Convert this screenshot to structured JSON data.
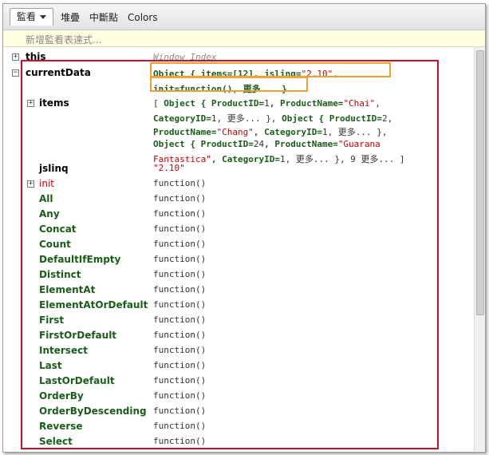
{
  "tabs": {
    "watch": "監看",
    "stack": "堆疊",
    "breakpoints": "中斷點",
    "colors": "Colors"
  },
  "add_watch_placeholder": "新增監看表達式...",
  "this_row": {
    "name": "this",
    "value": "Window",
    "value_suffix": "Index"
  },
  "currentData": {
    "name": "currentData",
    "summary_line1": {
      "prefix": "Object { ",
      "items": "items=[12]",
      "sep": ",  jslinq=",
      "jslinq": "\"2.10\"",
      "end": ","
    },
    "summary_line2": "init=function(),  更多... }"
  },
  "items_row": {
    "name": "items",
    "lines": [
      [
        {
          "t": "[ ",
          "c": "plain"
        },
        {
          "t": "Object { ",
          "c": "obj"
        },
        {
          "t": " ProductID=",
          "c": "obj"
        },
        {
          "t": "1",
          "c": "plain"
        },
        {
          "t": ",  ProductName=",
          "c": "obj"
        },
        {
          "t": "\"Chai\"",
          "c": "str"
        },
        {
          "t": ",",
          "c": "plain"
        }
      ],
      [
        {
          "t": "CategoryID=",
          "c": "obj"
        },
        {
          "t": "1",
          "c": "plain"
        },
        {
          "t": ",  更多... }",
          "c": "plain"
        },
        {
          "t": ", ",
          "c": "plain"
        },
        {
          "t": "Object { ",
          "c": "obj"
        },
        {
          "t": " ProductID=",
          "c": "obj"
        },
        {
          "t": "2",
          "c": "plain"
        },
        {
          "t": ",",
          "c": "plain"
        }
      ],
      [
        {
          "t": "ProductName=",
          "c": "obj"
        },
        {
          "t": "\"Chang\"",
          "c": "str"
        },
        {
          "t": ",  CategoryID=",
          "c": "obj"
        },
        {
          "t": "1",
          "c": "plain"
        },
        {
          "t": ",  更多... }",
          "c": "plain"
        },
        {
          "t": ",",
          "c": "plain"
        }
      ],
      [
        {
          "t": "Object { ",
          "c": "obj"
        },
        {
          "t": " ProductID=",
          "c": "obj"
        },
        {
          "t": "24",
          "c": "plain"
        },
        {
          "t": ",  ProductName=",
          "c": "obj"
        },
        {
          "t": "\"Guarana",
          "c": "str"
        }
      ],
      [
        {
          "t": "Fantastica\"",
          "c": "str"
        },
        {
          "t": ",  CategoryID=",
          "c": "obj"
        },
        {
          "t": "1",
          "c": "plain"
        },
        {
          "t": ",  更多... }",
          "c": "plain"
        },
        {
          "t": ", 9 更多... ]",
          "c": "plain"
        }
      ]
    ]
  },
  "jslinq_row": {
    "name": "jslinq",
    "value": "\"2.10\""
  },
  "init_row": {
    "name": "init",
    "value": "function()"
  },
  "methods": [
    {
      "name": "All",
      "value": "function()"
    },
    {
      "name": "Any",
      "value": "function()"
    },
    {
      "name": "Concat",
      "value": "function()"
    },
    {
      "name": "Count",
      "value": "function()"
    },
    {
      "name": "DefaultIfEmpty",
      "value": "function()"
    },
    {
      "name": "Distinct",
      "value": "function()"
    },
    {
      "name": "ElementAt",
      "value": "function()"
    },
    {
      "name": "ElementAtOrDefault",
      "value": "function()"
    },
    {
      "name": "First",
      "value": "function()"
    },
    {
      "name": "FirstOrDefault",
      "value": "function()"
    },
    {
      "name": "Intersect",
      "value": "function()"
    },
    {
      "name": "Last",
      "value": "function()"
    },
    {
      "name": "LastOrDefault",
      "value": "function()"
    },
    {
      "name": "OrderBy",
      "value": "function()"
    },
    {
      "name": "OrderByDescending",
      "value": "function()"
    },
    {
      "name": "Reverse",
      "value": "function()"
    },
    {
      "name": "Select",
      "value": "function()"
    }
  ],
  "icons": {
    "expand": "plus-box-icon",
    "collapse": "minus-box-icon",
    "dropdown": "chevron-down-icon"
  },
  "colors": {
    "highlight_red": "#c8102e",
    "highlight_orange": "#f0a030",
    "name_green": "#1a5c1a",
    "string_red": "#cc0000"
  }
}
